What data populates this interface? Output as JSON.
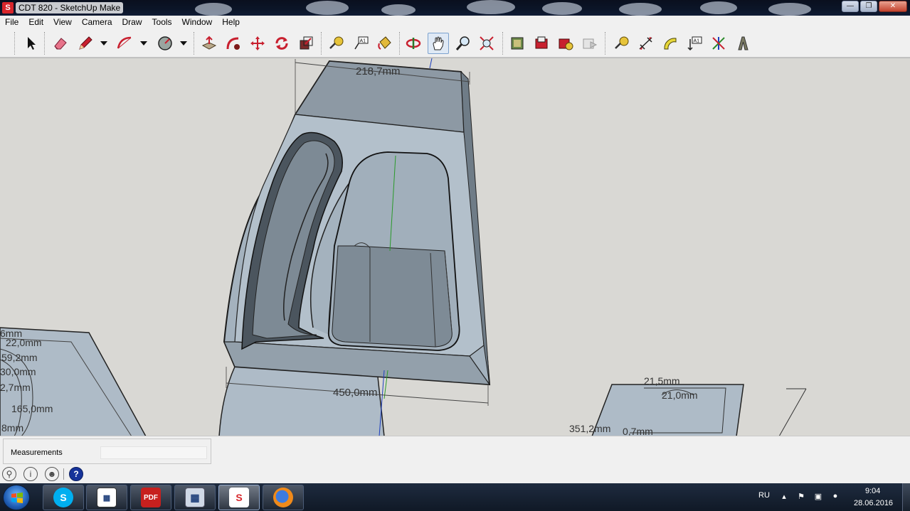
{
  "window": {
    "title": "CDT 820 - SketchUp Make",
    "app_icon": "sketchup-logo-icon"
  },
  "window_controls": {
    "minimize": "minimize-icon",
    "maximize": "maximize-icon",
    "close": "close-icon"
  },
  "menu": [
    "File",
    "Edit",
    "View",
    "Camera",
    "Draw",
    "Tools",
    "Window",
    "Help"
  ],
  "toolbar": {
    "tools": [
      "select-arrow-icon",
      "eraser-icon",
      "pencil-line-icon",
      "arc-icon",
      "circle-icon",
      "push-pull-icon",
      "follow-me-icon",
      "move-icon",
      "rotate-icon",
      "scale-icon",
      "tape-measure-icon",
      "text-label-icon",
      "paint-bucket-icon",
      "orbit-icon",
      "pan-hand-icon",
      "zoom-icon",
      "zoom-extents-icon",
      "warehouse-icon",
      "share-model-icon",
      "extension-warehouse-icon",
      "layout-icon",
      "tape-measure-icon",
      "dimension-icon",
      "protractor-icon",
      "text-icon",
      "axes-icon",
      "3d-text-icon"
    ],
    "active_tool": "pan-hand-icon"
  },
  "dimensions": {
    "top_width": "218,7mm",
    "bottom_width": "450,0mm",
    "left_labels": [
      "6mm",
      "22,0mm",
      "59,2mm",
      "30,0mm",
      "2,7mm",
      "165,0mm",
      "8mm"
    ],
    "right_label_1": "21,5mm",
    "right_label_2": "21,0mm",
    "right_label_3": "351,2mm",
    "right_label_4": "0,7mm"
  },
  "measurements": {
    "label": "Measurements",
    "value": ""
  },
  "status_icons": [
    "geo-location-icon",
    "credits-icon",
    "user-account-icon",
    "help-icon"
  ],
  "taskbar": {
    "apps": [
      "skype-icon",
      "spreadsheet-icon",
      "pdf-icon",
      "calculator-icon",
      "sketchup-icon",
      "firefox-icon"
    ],
    "active_app": "sketchup-icon",
    "language": "RU",
    "time": "9:04",
    "date": "28.06.2016"
  },
  "colors": {
    "model_face": "#a9b7c3",
    "model_shadow": "#6e7b86",
    "viewport_bg": "#d9d8d4",
    "taskbar": "#101926"
  }
}
